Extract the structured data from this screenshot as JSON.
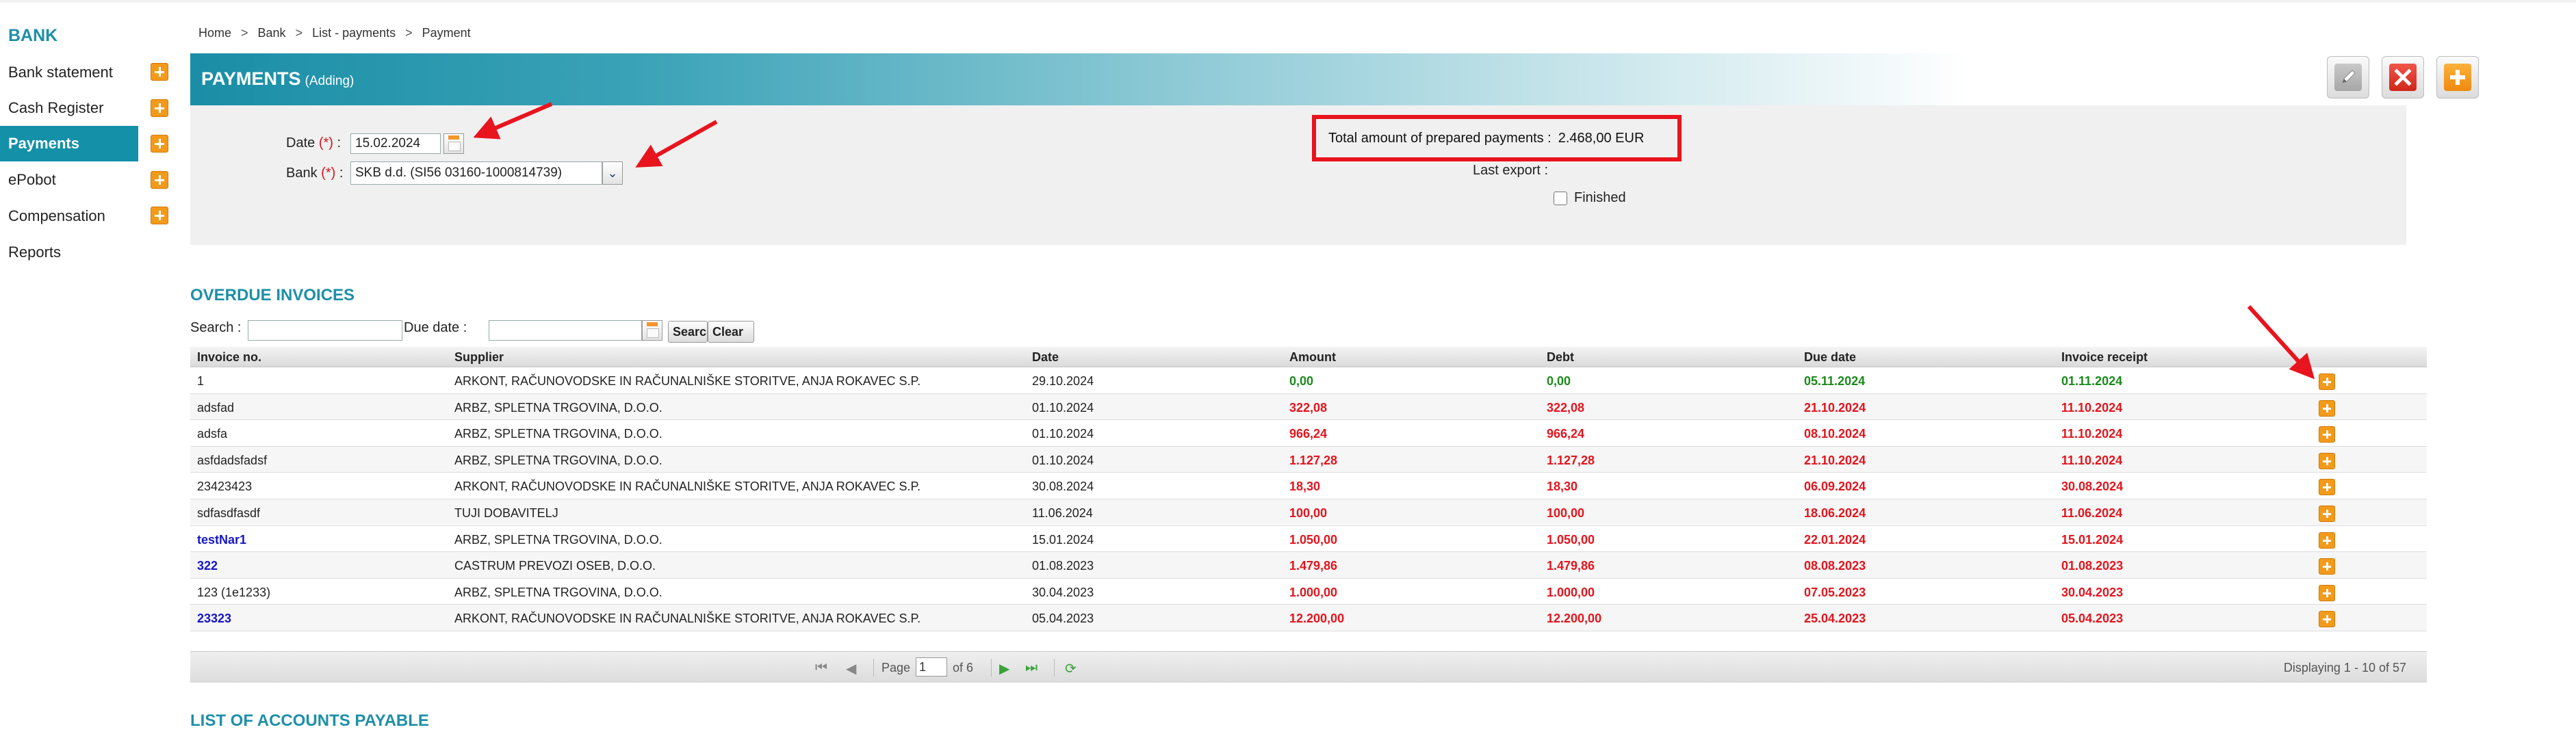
{
  "sidebar": {
    "title": "BANK",
    "items": [
      {
        "label": "Bank statement",
        "add": true
      },
      {
        "label": "Cash Register",
        "add": true
      },
      {
        "label": "Payments",
        "add": true,
        "active": true
      },
      {
        "label": "ePobot",
        "add": true
      },
      {
        "label": "Compensation",
        "add": true
      },
      {
        "label": "Reports",
        "add": false
      }
    ]
  },
  "breadcrumb": [
    "Home",
    "Bank",
    "List - payments",
    "Payment"
  ],
  "breadcrumb_sep": ">",
  "header": {
    "title": "PAYMENTS",
    "subtitle": "(Adding)",
    "icons": [
      "pencil-icon",
      "delete-icon",
      "add-icon"
    ]
  },
  "form": {
    "date_label": "Date",
    "bank_label": "Bank",
    "required_marker": "(*)",
    "colon": ":",
    "date_value": "15.02.2024",
    "bank_value": "SKB d.d. (SI56 03160-1000814739)",
    "total_label": "Total amount of prepared payments :",
    "total_value": "2.468,00 EUR",
    "last_export_label": "Last export :",
    "finished_label": "Finished",
    "finished_checked": false
  },
  "overdue": {
    "title": "OVERDUE INVOICES",
    "search_label": "Search :",
    "due_date_label": "Due date :",
    "search_button": "Search",
    "clear_button": "Clear",
    "columns": [
      "Invoice no.",
      "Supplier",
      "Date",
      "Amount",
      "Debt",
      "Due date",
      "Invoice receipt"
    ],
    "rows": [
      {
        "invoice": "1",
        "invoice_link": false,
        "supplier": "ARKONT, RAČUNOVODSKE IN RAČUNALNIŠKE STORITVE, ANJA ROKAVEC S.P.",
        "date": "29.10.2024",
        "amount": "0,00",
        "debt": "0,00",
        "due": "05.11.2024",
        "receipt": "01.11.2024",
        "status": "green"
      },
      {
        "invoice": "adsfad",
        "invoice_link": false,
        "supplier": "ARBZ, SPLETNA TRGOVINA, D.O.O.",
        "date": "01.10.2024",
        "amount": "322,08",
        "debt": "322,08",
        "due": "21.10.2024",
        "receipt": "11.10.2024",
        "status": "red"
      },
      {
        "invoice": "adsfa",
        "invoice_link": false,
        "supplier": "ARBZ, SPLETNA TRGOVINA, D.O.O.",
        "date": "01.10.2024",
        "amount": "966,24",
        "debt": "966,24",
        "due": "08.10.2024",
        "receipt": "11.10.2024",
        "status": "red"
      },
      {
        "invoice": "asfdadsfadsf",
        "invoice_link": false,
        "supplier": "ARBZ, SPLETNA TRGOVINA, D.O.O.",
        "date": "01.10.2024",
        "amount": "1.127,28",
        "debt": "1.127,28",
        "due": "21.10.2024",
        "receipt": "11.10.2024",
        "status": "red"
      },
      {
        "invoice": "23423423",
        "invoice_link": false,
        "supplier": "ARKONT, RAČUNOVODSKE IN RAČUNALNIŠKE STORITVE, ANJA ROKAVEC S.P.",
        "date": "30.08.2024",
        "amount": "18,30",
        "debt": "18,30",
        "due": "06.09.2024",
        "receipt": "30.08.2024",
        "status": "red"
      },
      {
        "invoice": "sdfasdfasdf",
        "invoice_link": false,
        "supplier": "TUJI DOBAVITELJ",
        "date": "11.06.2024",
        "amount": "100,00",
        "debt": "100,00",
        "due": "18.06.2024",
        "receipt": "11.06.2024",
        "status": "red"
      },
      {
        "invoice": "testNar1",
        "invoice_link": true,
        "supplier": "ARBZ, SPLETNA TRGOVINA, D.O.O.",
        "date": "15.01.2024",
        "amount": "1.050,00",
        "debt": "1.050,00",
        "due": "22.01.2024",
        "receipt": "15.01.2024",
        "status": "red"
      },
      {
        "invoice": "322",
        "invoice_link": true,
        "supplier": "CASTRUM PREVOZI OSEB, D.O.O.",
        "date": "01.08.2023",
        "amount": "1.479,86",
        "debt": "1.479,86",
        "due": "08.08.2023",
        "receipt": "01.08.2023",
        "status": "red"
      },
      {
        "invoice": "123 (1e1233)",
        "invoice_link": false,
        "supplier": "ARBZ, SPLETNA TRGOVINA, D.O.O.",
        "date": "30.04.2023",
        "amount": "1.000,00",
        "debt": "1.000,00",
        "due": "07.05.2023",
        "receipt": "30.04.2023",
        "status": "red"
      },
      {
        "invoice": "23323",
        "invoice_link": true,
        "supplier": "ARKONT, RAČUNOVODSKE IN RAČUNALNIŠKE STORITVE, ANJA ROKAVEC S.P.",
        "date": "05.04.2023",
        "amount": "12.200,00",
        "debt": "12.200,00",
        "due": "25.04.2023",
        "receipt": "05.04.2023",
        "status": "red"
      }
    ],
    "pager": {
      "page_label": "Page",
      "page_value": "1",
      "of_label": "of 6",
      "display_text": "Displaying 1 - 10 of 57"
    }
  },
  "accounts_payable": {
    "title": "LIST OF ACCOUNTS PAYABLE"
  },
  "colors": {
    "accent": "#1e8fa8",
    "active_nav": "#1490a8",
    "overdue_red": "#e3141c",
    "ok_green": "#1b8a1b",
    "link_blue": "#1515c9",
    "plus_orange": "#f39a1a",
    "annotation_red": "#e8141e"
  }
}
